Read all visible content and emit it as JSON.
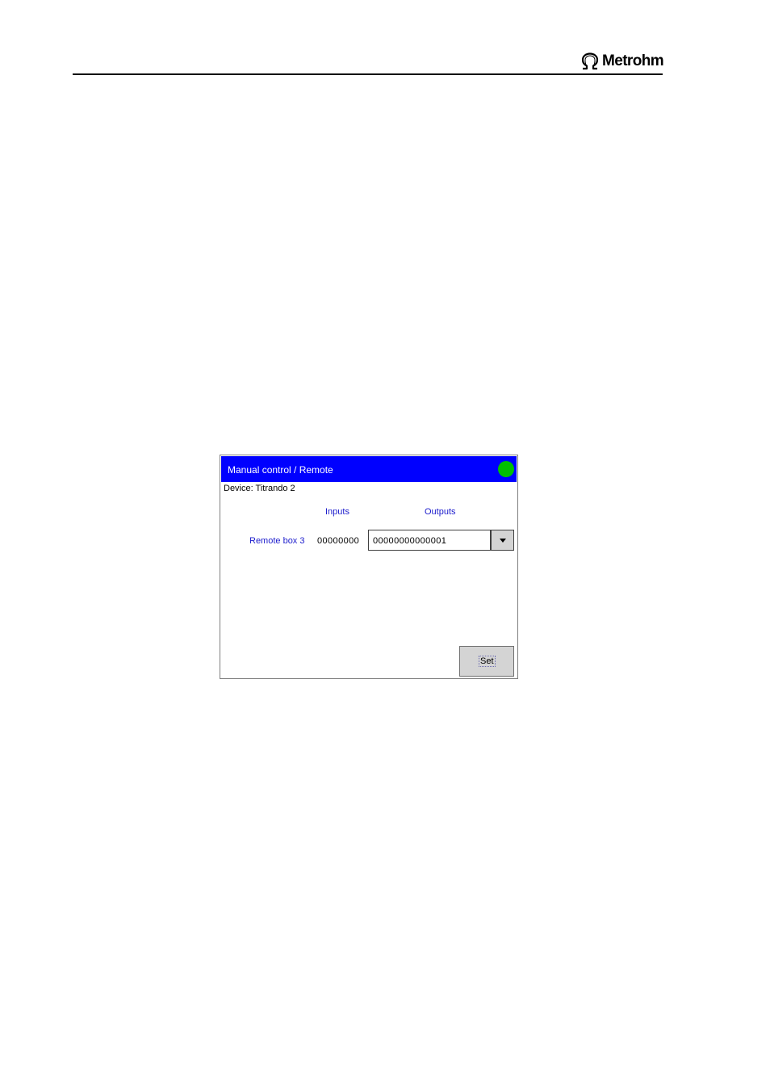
{
  "document_header": {
    "brand": "Metrohm",
    "logo_icon": "omega-logo-icon"
  },
  "screen": {
    "title": "Manual control / Remote",
    "status_indicator_color": "#00c000",
    "title_bar_color": "#0000ff",
    "device_label": "Device: Titrando 2",
    "columns": {
      "inputs": "Inputs",
      "outputs": "Outputs"
    },
    "remote_box": {
      "label": "Remote box 3",
      "inputs_value": "00000000",
      "outputs_value": "00000000000001"
    },
    "dropdown_icon": "triangle-down-icon",
    "set_button_label": "Set"
  }
}
